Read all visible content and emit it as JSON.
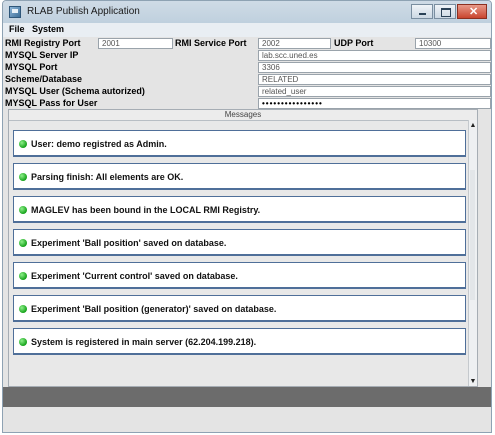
{
  "window": {
    "title": "RLAB Publish Application"
  },
  "menu": {
    "file": "File",
    "system": "System"
  },
  "config": {
    "rmi_registry_port_label": "RMI Registry Port",
    "rmi_registry_port": "2001",
    "rmi_service_port_label": "RMI Service Port",
    "rmi_service_port": "2002",
    "udp_port_label": "UDP Port",
    "udp_port": "10300",
    "mysql_server_ip_label": "MYSQL Server IP",
    "mysql_server_ip": "lab.scc.uned.es",
    "mysql_port_label": "MYSQL Port",
    "mysql_port": "3306",
    "scheme_label": "Scheme/Database",
    "scheme": "RELATED",
    "mysql_user_label": "MYSQL User (Schema autorized)",
    "mysql_user": "related_user",
    "mysql_pass_label": "MYSQL Pass for User",
    "mysql_pass": "••••••••••••••••"
  },
  "messages": {
    "header": "Messages",
    "items": [
      "User: demo registred as Admin.",
      "Parsing finish: All elements are OK.",
      "MAGLEV has been bound in the LOCAL RMI Registry.",
      "Experiment 'Ball position' saved on database.",
      "Experiment 'Current control' saved on database.",
      "Experiment 'Ball position (generator)' saved on database.",
      "System is registered in main server (62.204.199.218)."
    ],
    "status_color": "#22b325"
  },
  "icons": {
    "app": "app-window-icon",
    "minimize": "minimize-icon",
    "maximize": "maximize-icon",
    "close": "close-icon",
    "status": "green-status-dot-icon"
  }
}
